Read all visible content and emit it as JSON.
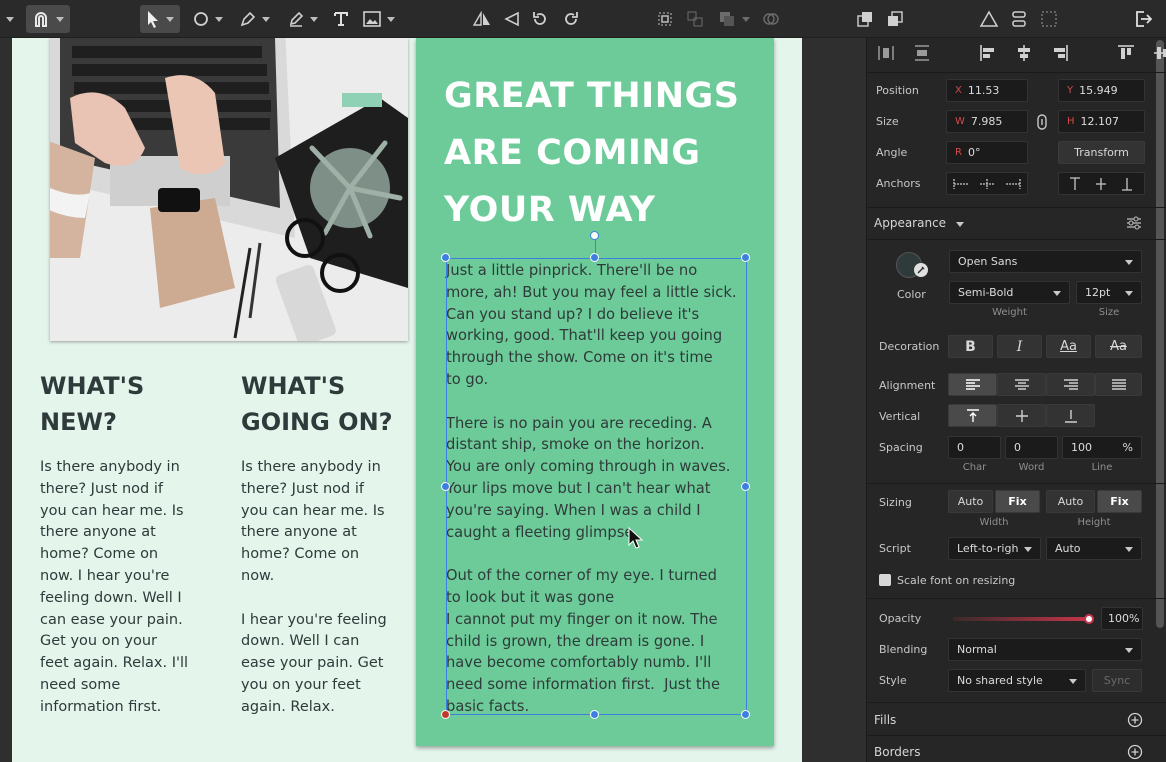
{
  "canvas": {
    "col1": {
      "title": "WHAT'S\nNEW?",
      "body": "Is there anybody in\nthere? Just nod if\nyou can hear me. Is\nthere anyone at\nhome? Come on\nnow. I hear you're\nfeeling down. Well I\ncan ease your pain.\nGet you on your\nfeet again. Relax. I'll\nneed some\ninformation first."
    },
    "col2": {
      "title": "WHAT'S\nGOING ON?",
      "body": "Is there anybody in\nthere? Just nod if\nyou can hear me. Is\nthere anyone at\nhome? Come on\nnow.\n\nI hear you're feeling\ndown. Well I can\nease your pain. Get\nyou on your feet\nagain. Relax."
    },
    "card": {
      "title": "GREAT THINGS\nARE COMING\nYOUR WAY",
      "body": "Just a little pinprick. There'll be no\nmore, ah! But you may feel a little sick.\nCan you stand up? I do believe it's\nworking, good. That'll keep you going\nthrough the show. Come on it's time\nto go.\n\nThere is no pain you are receding. A\ndistant ship, smoke on the horizon.\nYou are only coming through in waves.\nYour lips move but I can't hear what\nyou're saying. When I was a child I\ncaught a fleeting glimpse.\n\nOut of the corner of my eye. I turned\nto look but it was gone\nI cannot put my finger on it now. The\nchild is grown, the dream is gone. I\nhave become comfortably numb. I'll\nneed some information first.  Just the\nbasic facts."
    }
  },
  "inspector": {
    "position_label": "Position",
    "x_prefix": "X",
    "x_value": "11.53",
    "y_prefix": "Y",
    "y_value": "15.949",
    "size_label": "Size",
    "w_prefix": "W",
    "w_value": "7.985",
    "h_prefix": "H",
    "h_value": "12.107",
    "angle_label": "Angle",
    "r_prefix": "R",
    "angle_value": "0°",
    "transform_button": "Transform",
    "anchors_label": "Anchors",
    "appearance_label": "Appearance",
    "color_label": "Color",
    "font_family": "Open Sans",
    "font_weight": "Semi-Bold",
    "font_size": "12pt",
    "weight_sub": "Weight",
    "size_sub": "Size",
    "decoration_label": "Decoration",
    "deco_bold": "B",
    "deco_italic": "I",
    "deco_case": "Aa",
    "deco_strike": "Aa",
    "alignment_label": "Alignment",
    "vertical_label": "Vertical",
    "spacing_label": "Spacing",
    "spacing_char": "0",
    "spacing_word": "0",
    "spacing_line": "100",
    "spacing_unit": "%",
    "char_sub": "Char",
    "word_sub": "Word",
    "line_sub": "Line",
    "sizing_label": "Sizing",
    "auto1": "Auto",
    "fix1": "Fix",
    "auto2": "Auto",
    "fix2": "Fix",
    "width_sub": "Width",
    "height_sub": "Height",
    "script_label": "Script",
    "script_dir": "Left-to-righ",
    "script_auto": "Auto",
    "scale_font_label": "Scale font on resizing",
    "opacity_label": "Opacity",
    "opacity_value": "100%",
    "blending_label": "Blending",
    "blending_value": "Normal",
    "style_label": "Style",
    "style_value": "No shared style",
    "sync_button": "Sync",
    "fills_label": "Fills",
    "borders_label": "Borders"
  },
  "colors": {
    "card_green": "#6ccb98",
    "page_bg": "#e4f5ec",
    "selection_blue": "#3d7fe0",
    "opacity_slider": "#c7354b"
  },
  "icons": [
    "magnet-icon",
    "pointer-icon",
    "ellipse-icon",
    "pen-icon",
    "pencil-icon",
    "text-icon",
    "image-icon",
    "flip-horizontal-icon",
    "flip-vertical-icon",
    "rotate-ccw-icon",
    "rotate-cw-icon",
    "group-icon",
    "ungroup-icon",
    "boolean-icon",
    "mask-icon",
    "bring-forward-icon",
    "send-backward-icon",
    "symbol-icon",
    "component-icon",
    "artboard-icon",
    "export-icon"
  ]
}
